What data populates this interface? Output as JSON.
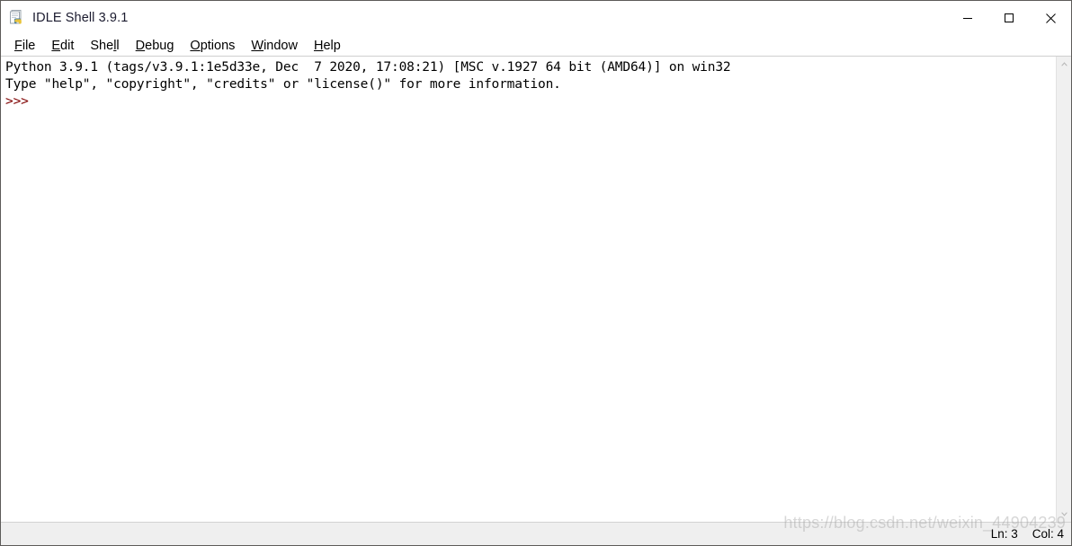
{
  "window": {
    "title": "IDLE Shell 3.9.1",
    "icon": "idle-python-icon",
    "controls": {
      "minimize": "minimize-button",
      "maximize": "maximize-button",
      "close": "close-button"
    }
  },
  "menubar": {
    "items": [
      {
        "label": "File",
        "pre": "",
        "accel": "F",
        "post": "ile"
      },
      {
        "label": "Edit",
        "pre": "",
        "accel": "E",
        "post": "dit"
      },
      {
        "label": "Shell",
        "pre": "She",
        "accel": "l",
        "post": "l"
      },
      {
        "label": "Debug",
        "pre": "",
        "accel": "D",
        "post": "ebug"
      },
      {
        "label": "Options",
        "pre": "",
        "accel": "O",
        "post": "ptions"
      },
      {
        "label": "Window",
        "pre": "",
        "accel": "W",
        "post": "indow"
      },
      {
        "label": "Help",
        "pre": "",
        "accel": "H",
        "post": "elp"
      }
    ]
  },
  "shell": {
    "lines": [
      {
        "text": "Python 3.9.1 (tags/v3.9.1:1e5d33e, Dec  7 2020, 17:08:21) [MSC v.1927 64 bit (AMD64)] on win32",
        "kind": "output"
      },
      {
        "text": "Type \"help\", \"copyright\", \"credits\" or \"license()\" for more information.",
        "kind": "output"
      },
      {
        "text": ">>> ",
        "kind": "prompt"
      }
    ]
  },
  "scrollbar": {
    "up_arrow": "scroll-up-arrow",
    "down_arrow": "scroll-down-arrow"
  },
  "statusbar": {
    "line_label": "Ln: 3",
    "col_label": "Col: 4",
    "watermark": "https://blog.csdn.net/weixin_44904239"
  },
  "colors": {
    "prompt": "#7f0000",
    "text": "#000000",
    "background": "#ffffff",
    "statusbar_bg": "#efefef",
    "scrollbar_bg": "#f0f0f0",
    "window_border": "#5d5b59"
  }
}
